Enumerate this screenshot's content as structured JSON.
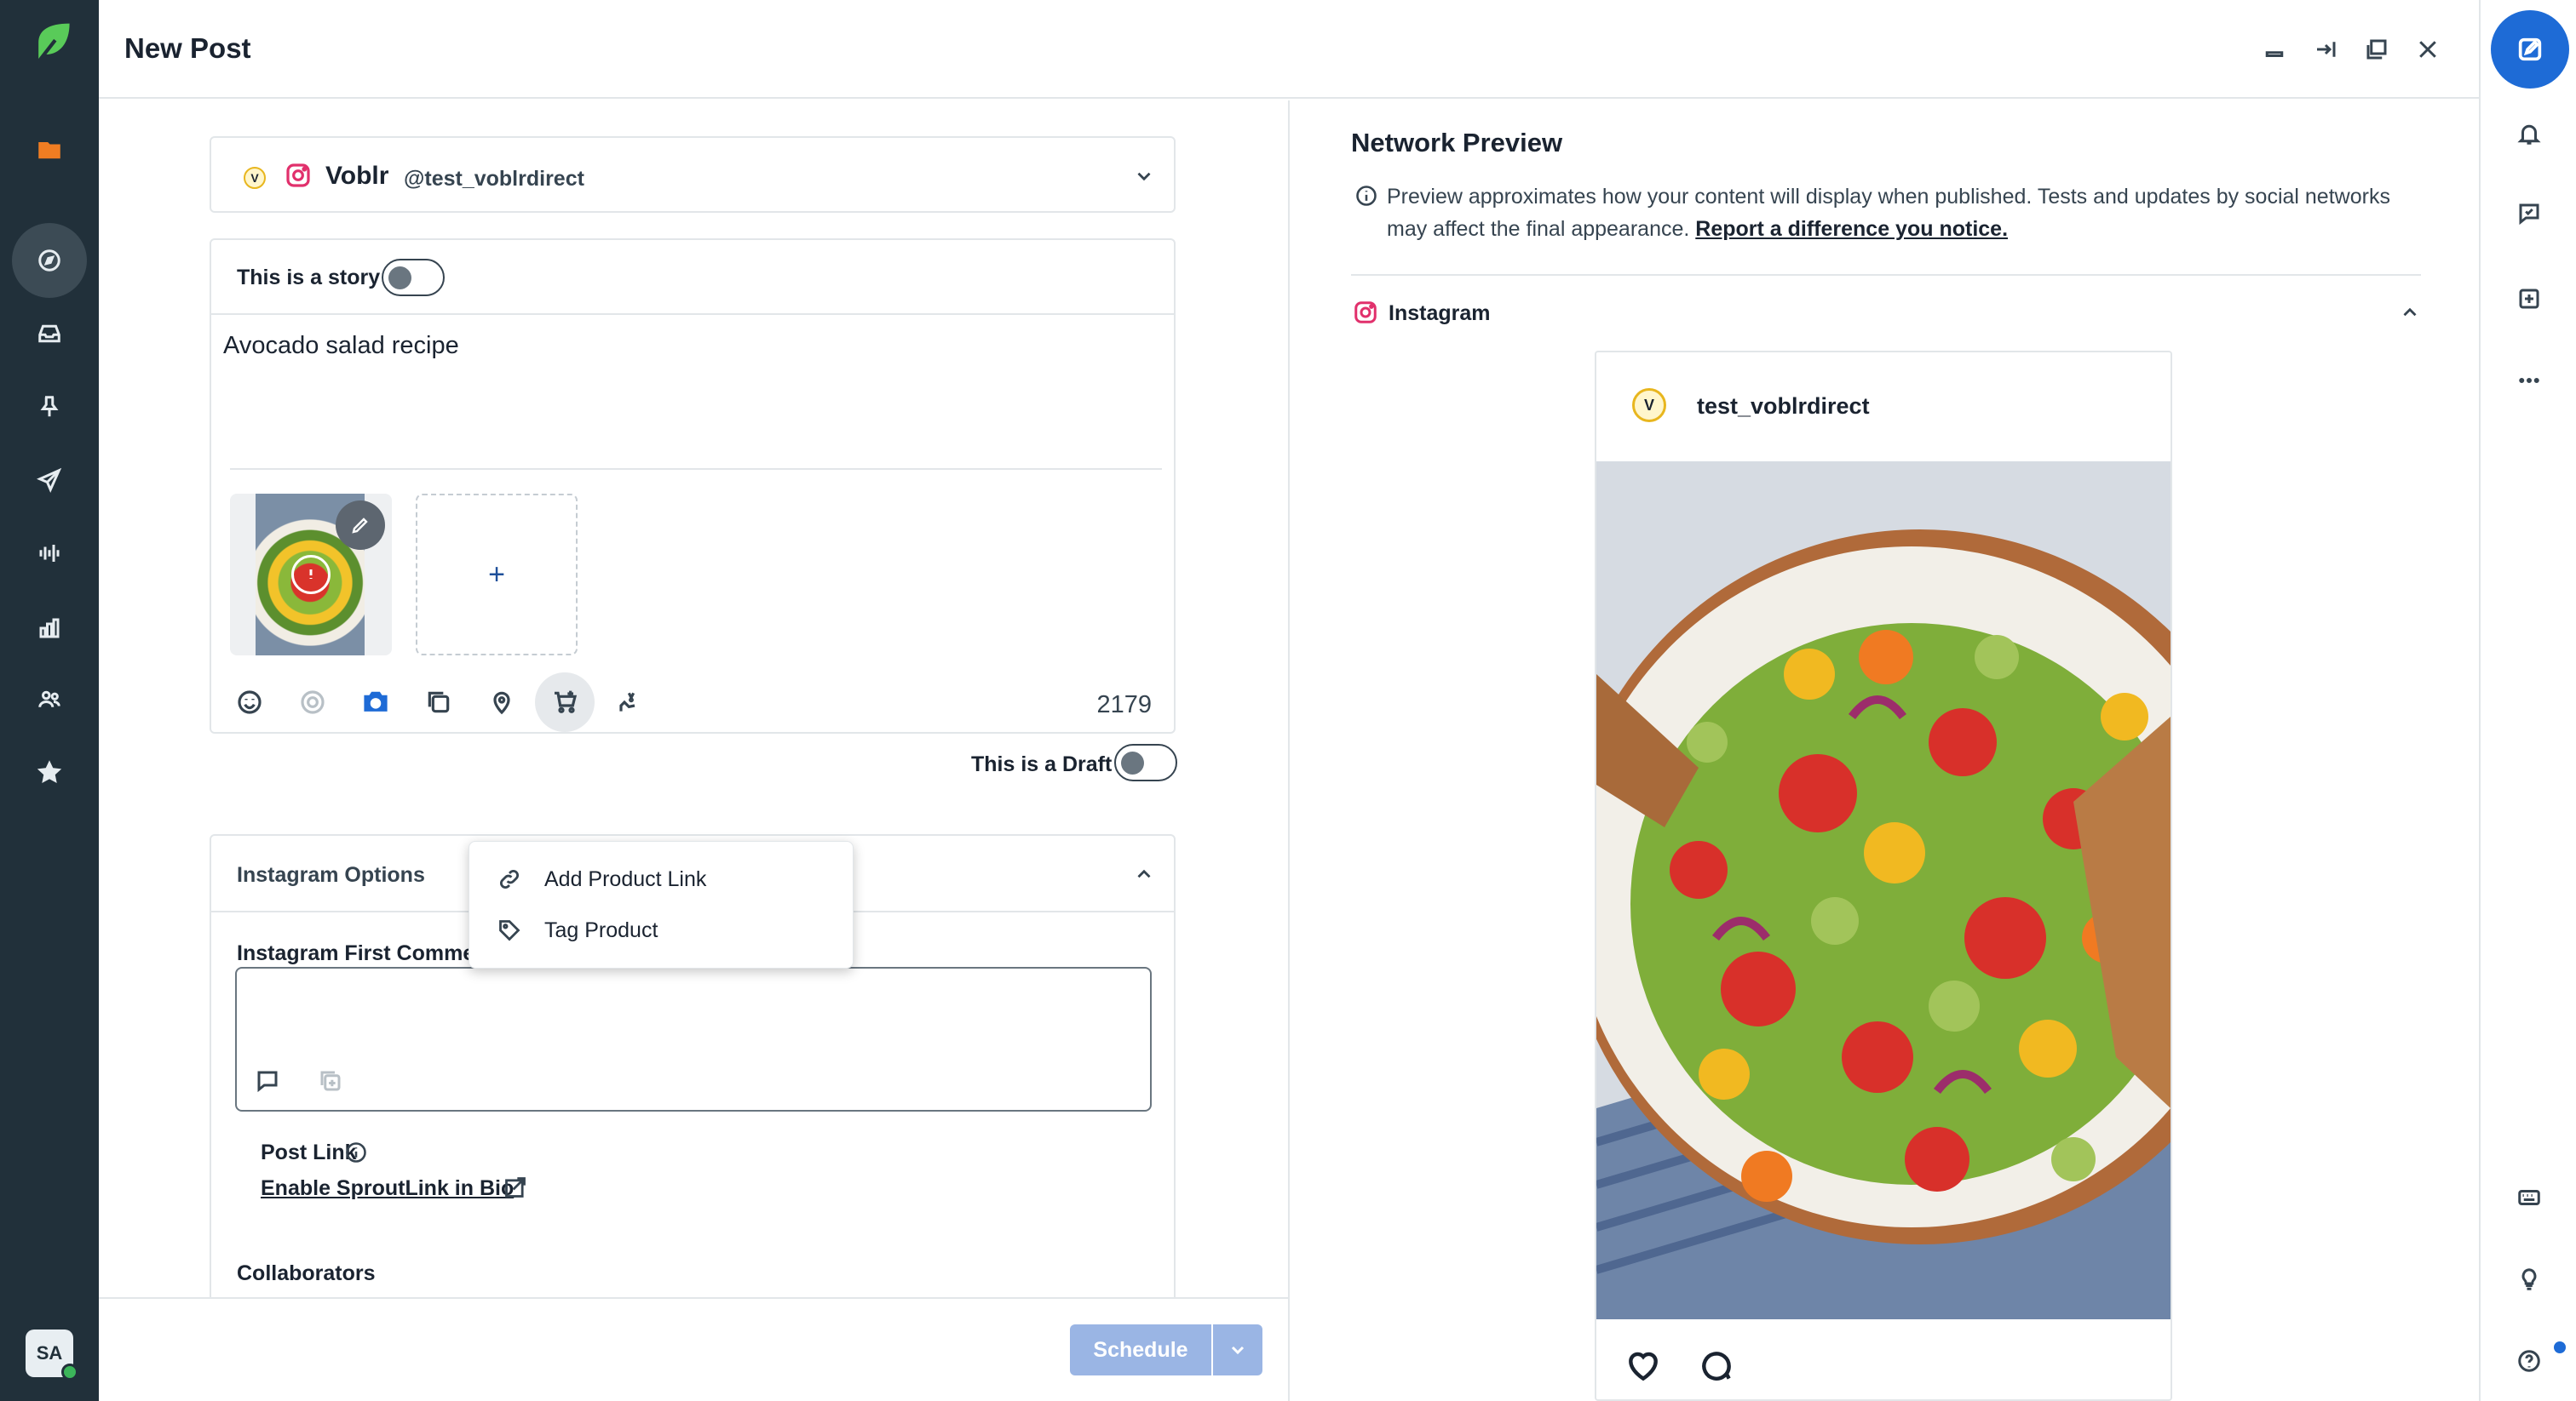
{
  "header": {
    "title": "New Post"
  },
  "account": {
    "initial": "V",
    "name": "Voblr",
    "handle": "@test_voblrdirect"
  },
  "editor": {
    "story_label": "This is a story",
    "post_text": "Avocado salad recipe",
    "add_media_symbol": "+",
    "char_count": "2179"
  },
  "draft": {
    "label": "This is a Draft"
  },
  "product_menu": {
    "items": [
      {
        "label": "Add Product Link",
        "icon": "link-icon"
      },
      {
        "label": "Tag Product",
        "icon": "tag-icon"
      }
    ]
  },
  "instagram_options": {
    "title": "Instagram Options",
    "first_comment_label": "Instagram First Comment",
    "post_link_label": "Post Link",
    "sproutlink_label": "Enable SproutLink in Bio",
    "collaborators_label": "Collaborators"
  },
  "footer": {
    "schedule_label": "Schedule"
  },
  "preview": {
    "title": "Network Preview",
    "note": "Preview approximates how your content will display when published. Tests and updates by social networks may affect the final appearance.",
    "report_link": "Report a difference you notice.",
    "network": "Instagram",
    "username": "test_voblrdirect",
    "avatar_initial": "V"
  },
  "user": {
    "initials": "SA"
  },
  "colors": {
    "nav_bg": "#21303a",
    "accent": "#1e6bd6",
    "instagram": "#e1306c",
    "schedule_disabled": "#9ab5e4"
  }
}
